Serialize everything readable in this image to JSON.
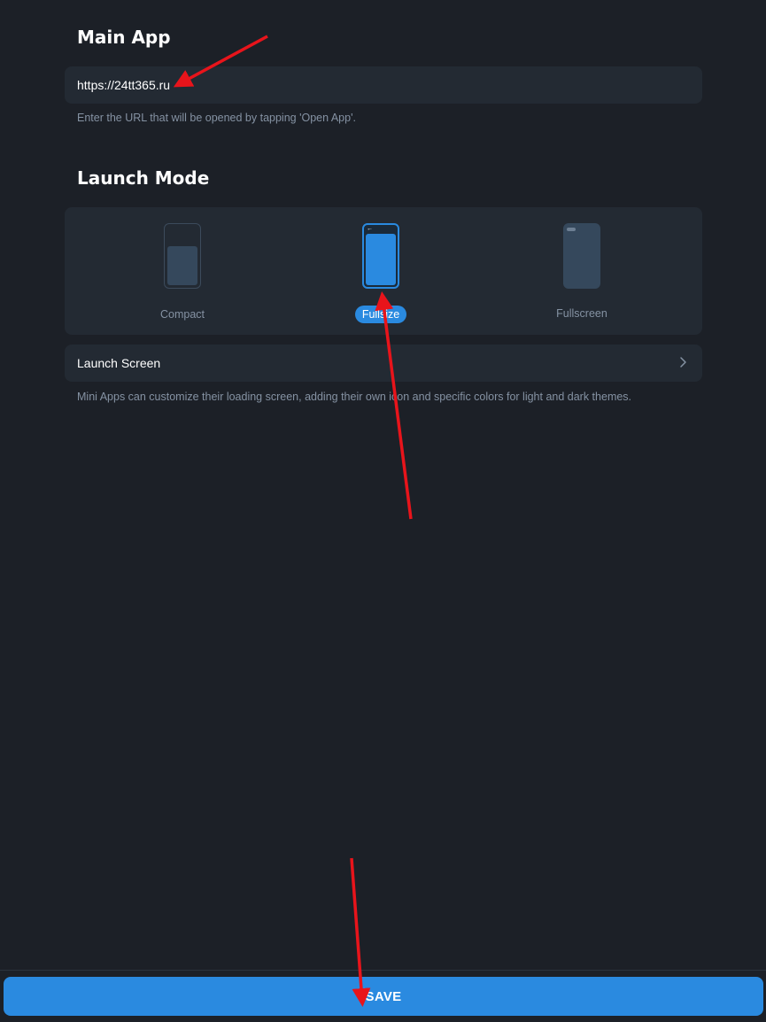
{
  "main_app": {
    "title": "Main App",
    "url_value": "https://24tt365.ru",
    "hint": "Enter the URL that will be opened by tapping 'Open App'."
  },
  "launch_mode": {
    "title": "Launch Mode",
    "modes": [
      {
        "label": "Compact",
        "selected": false
      },
      {
        "label": "Fullsize",
        "selected": true
      },
      {
        "label": "Fullscreen",
        "selected": false
      }
    ],
    "back_glyph": "←"
  },
  "launch_screen": {
    "label": "Launch Screen",
    "hint": "Mini Apps can customize their loading screen, adding their own icon and specific colors for light and dark themes."
  },
  "footer": {
    "save_label": "SAVE"
  },
  "colors": {
    "background": "#1c2027",
    "card": "#232a33",
    "accent": "#2a8ae0",
    "muted_text": "#8592a3",
    "annotation_arrow": "#e8141b"
  }
}
